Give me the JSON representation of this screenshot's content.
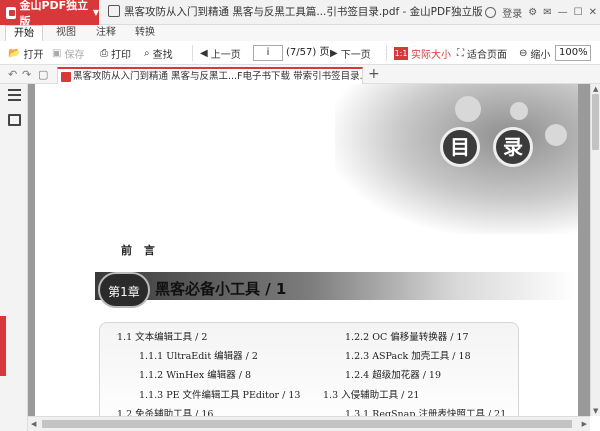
{
  "app": {
    "name": "金山PDF独立版"
  },
  "window": {
    "title": "黑客攻防从入门到精通 黑客与反黑工具篇...引书签目录.pdf - 金山PDF独立版"
  },
  "topright": {
    "login": "登录"
  },
  "menu": {
    "tabs": [
      "开始",
      "视图",
      "注释",
      "转换"
    ]
  },
  "toolbar": {
    "open": "打开",
    "save": "保存",
    "print": "打印",
    "find": "查找",
    "prev": "上一页",
    "page_value": "i",
    "page_count": "(7/57) 页",
    "next": "下一页",
    "actual_size": "实际大小",
    "fit_page": "适合页面",
    "zoom_out": "缩小",
    "zoom_value": "100%"
  },
  "doc_tabs": [
    {
      "label": "黑客攻防从入门到精通  黑客与反黑工...F电子书下载 带索引书签目录.pdf",
      "active": true
    }
  ],
  "document": {
    "mulu_chars": [
      "目",
      "录"
    ],
    "preface": "前  言",
    "chapter_badge": "第1章",
    "chapter_title": "黑客必备小工具  / 1",
    "toc_left": [
      "1.1   文本编辑工具  / 2",
      "1.1.1   UltraEdit 编辑器  / 2",
      "1.1.2   WinHex 编辑器  / 8",
      "1.1.3   PE 文件编辑工具 PEditor  / 13",
      "1.2   免杀辅助工具  / 16"
    ],
    "toc_right": [
      "1.2.2   OC 偏移量转换器  / 17",
      "1.2.3   ASPack 加壳工具  / 18",
      "1.2.4   超级加花器  / 19",
      "1.3   入侵辅助工具  / 21",
      "1.3.1   RegSnap 注册表快照工具  / 21"
    ]
  },
  "icons": [
    "logo-icon",
    "user-icon",
    "settings-icon",
    "open-icon",
    "save-icon",
    "print-icon",
    "search-icon",
    "prev-icon",
    "next-icon",
    "actual-size-icon",
    "fit-page-icon",
    "undo-icon",
    "redo-icon",
    "list-icon",
    "comment-icon"
  ],
  "colors": {
    "accent": "#d9383a"
  }
}
